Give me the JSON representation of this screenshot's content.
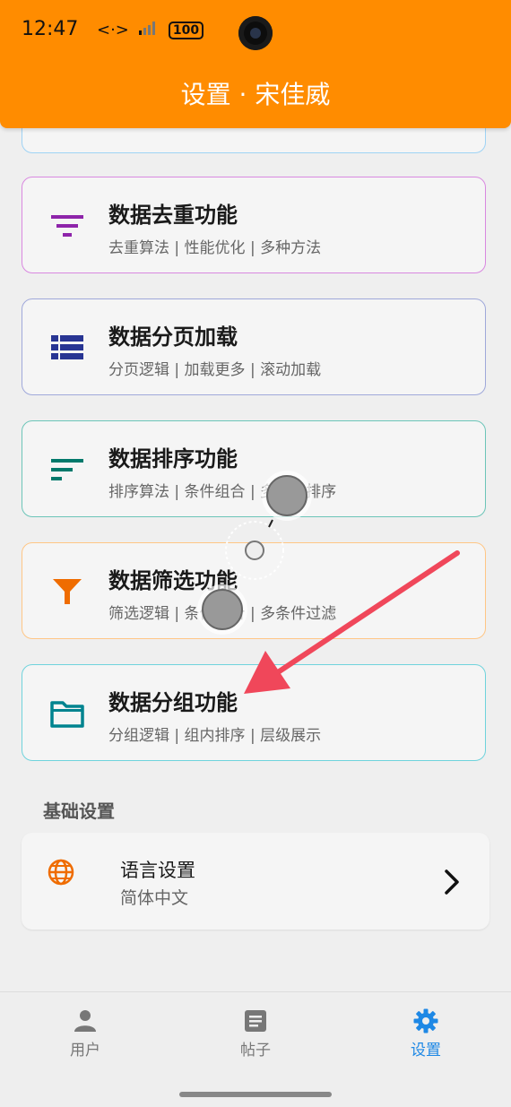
{
  "status_bar": {
    "time": "12:47",
    "battery": "100"
  },
  "header": {
    "title": "设置 · 宋佳威"
  },
  "cards": [
    {
      "title": "数据去重功能",
      "subtitle": "去重算法 | 性能优化 | 多种方法",
      "icon": "filter-list-icon",
      "color": "#8e24aa",
      "border": "#d988e0"
    },
    {
      "title": "数据分页加载",
      "subtitle": "分页逻辑 | 加载更多 | 滚动加载",
      "icon": "view-list-icon",
      "color": "#283593",
      "border": "#9fa8da"
    },
    {
      "title": "数据排序功能",
      "subtitle": "排序算法 | 条件组合 | 多字段排序",
      "icon": "sort-icon",
      "color": "#00796b",
      "border": "#6cc5b8"
    },
    {
      "title": "数据筛选功能",
      "subtitle": "筛选逻辑 | 条件组合 | 多条件过滤",
      "icon": "funnel-icon",
      "color": "#ef6c00",
      "border": "#ffc685"
    },
    {
      "title": "数据分组功能",
      "subtitle": "分组逻辑 | 组内排序 | 层级展示",
      "icon": "folder-icon",
      "color": "#00838f",
      "border": "#6fd3dc"
    }
  ],
  "section": {
    "title": "基础设置"
  },
  "language": {
    "title": "语言设置",
    "value": "简体中文"
  },
  "bottom_nav": {
    "items": [
      {
        "label": "用户",
        "icon": "person-icon"
      },
      {
        "label": "帖子",
        "icon": "article-icon"
      },
      {
        "label": "设置",
        "icon": "gear-icon",
        "active": true
      }
    ]
  },
  "colors": {
    "accent": "#ff8c00",
    "nav_active": "#1e88e5"
  }
}
